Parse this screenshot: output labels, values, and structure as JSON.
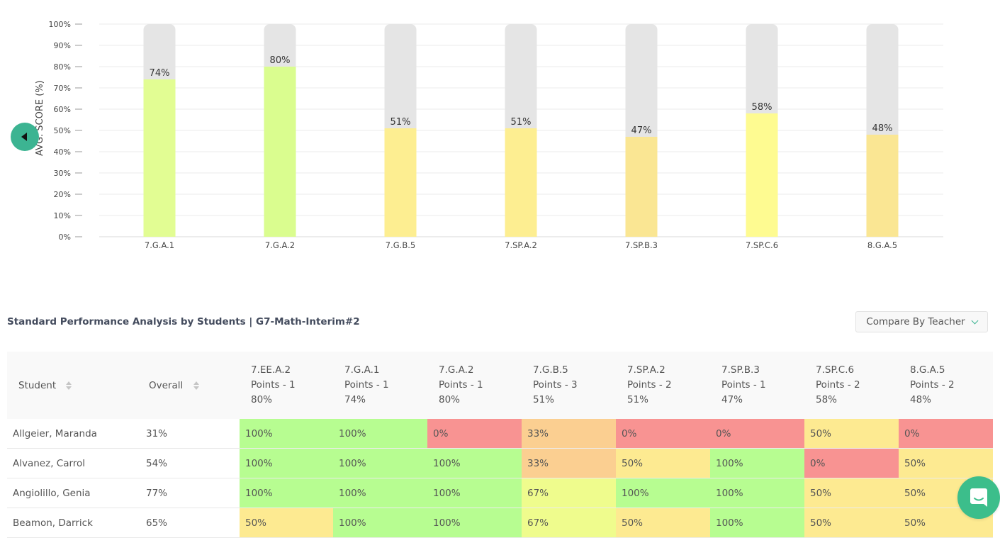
{
  "chart_data": {
    "type": "bar",
    "title": "",
    "xlabel": "",
    "ylabel": "AVG. SCORE (%)",
    "ylim": [
      0,
      100
    ],
    "yticks": [
      "0%",
      "10%",
      "20%",
      "30%",
      "40%",
      "50%",
      "60%",
      "70%",
      "80%",
      "90%",
      "100%"
    ],
    "grid": true,
    "categories": [
      "7.G.A.1",
      "7.G.A.2",
      "7.G.B.5",
      "7.SP.A.2",
      "7.SP.B.3",
      "7.SP.C.6",
      "8.G.A.5"
    ],
    "values": [
      74,
      80,
      51,
      51,
      47,
      58,
      48
    ],
    "data_labels": [
      "74%",
      "80%",
      "51%",
      "51%",
      "47%",
      "58%",
      "48%"
    ],
    "bar_colors": [
      "#e2fd93",
      "#dafd8f",
      "#fdee91",
      "#fdee91",
      "#fae693",
      "#fefb91",
      "#fae693"
    ],
    "background_bar_color": "#e5e5e5"
  },
  "nav": {
    "collapse_icon": "caret-left-icon"
  },
  "section": {
    "title": "Standard Performance Analysis by Students | G7-Math-Interim#2",
    "compare_label": "Compare By Teacher"
  },
  "table": {
    "columns": {
      "student": "Student",
      "overall": "Overall",
      "standards": [
        {
          "code": "7.EE.A.2",
          "points": "Points - 1",
          "avg": "80%"
        },
        {
          "code": "7.G.A.1",
          "points": "Points - 1",
          "avg": "74%"
        },
        {
          "code": "7.G.A.2",
          "points": "Points - 1",
          "avg": "80%"
        },
        {
          "code": "7.G.B.5",
          "points": "Points - 3",
          "avg": "51%"
        },
        {
          "code": "7.SP.A.2",
          "points": "Points - 2",
          "avg": "51%"
        },
        {
          "code": "7.SP.B.3",
          "points": "Points - 1",
          "avg": "47%"
        },
        {
          "code": "7.SP.C.6",
          "points": "Points - 2",
          "avg": "58%"
        },
        {
          "code": "8.G.A.5",
          "points": "Points - 2",
          "avg": "48%"
        }
      ]
    },
    "rows": [
      {
        "name": "Allgeier, Maranda",
        "overall": "31%",
        "scores": [
          "100%",
          "100%",
          "0%",
          "33%",
          "0%",
          "0%",
          "50%",
          "0%"
        ]
      },
      {
        "name": "Alvanez, Carrol",
        "overall": "54%",
        "scores": [
          "100%",
          "100%",
          "100%",
          "33%",
          "50%",
          "100%",
          "0%",
          "50%"
        ]
      },
      {
        "name": "Angiolillo, Genia",
        "overall": "77%",
        "scores": [
          "100%",
          "100%",
          "100%",
          "67%",
          "100%",
          "100%",
          "50%",
          "50%"
        ]
      },
      {
        "name": "Beamon, Darrick",
        "overall": "65%",
        "scores": [
          "50%",
          "100%",
          "100%",
          "67%",
          "50%",
          "100%",
          "50%",
          "50%"
        ]
      }
    ],
    "score_colors": {
      "100%": "#b7fd91",
      "67%": "#effc8d",
      "50%": "#fdea91",
      "33%": "#fbcf91",
      "0%": "#f89392"
    }
  },
  "chat": {
    "icon": "chat-bubble-icon"
  }
}
